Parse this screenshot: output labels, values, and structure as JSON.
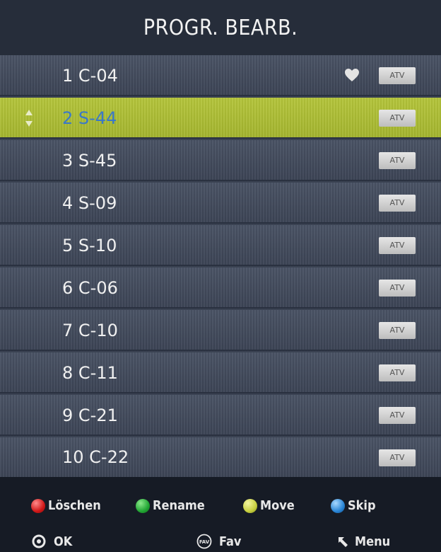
{
  "title": "PROGR. BEARB.",
  "channels": [
    {
      "label": "1 C-04",
      "badge": "ATV",
      "favorite": true,
      "selected": false
    },
    {
      "label": "2 S-44",
      "badge": "ATV",
      "favorite": false,
      "selected": true
    },
    {
      "label": "3 S-45",
      "badge": "ATV",
      "favorite": false,
      "selected": false
    },
    {
      "label": "4 S-09",
      "badge": "ATV",
      "favorite": false,
      "selected": false
    },
    {
      "label": "5 S-10",
      "badge": "ATV",
      "favorite": false,
      "selected": false
    },
    {
      "label": "6 C-06",
      "badge": "ATV",
      "favorite": false,
      "selected": false
    },
    {
      "label": "7 C-10",
      "badge": "ATV",
      "favorite": false,
      "selected": false
    },
    {
      "label": "8 C-11",
      "badge": "ATV",
      "favorite": false,
      "selected": false
    },
    {
      "label": "9 C-21",
      "badge": "ATV",
      "favorite": false,
      "selected": false
    },
    {
      "label": "10 C-22",
      "badge": "ATV",
      "favorite": false,
      "selected": false
    }
  ],
  "hints": {
    "red": "Löschen",
    "green": "Rename",
    "yellow": "Move",
    "blue": "Skip",
    "ok": "OK",
    "fav": "Fav",
    "fav_icon_text": "FAV",
    "menu": "Menu"
  },
  "colors": {
    "selected_row": "#a3b42e",
    "selected_text": "#3a78c8",
    "row": "#434b5d"
  },
  "icons": {
    "favorite": "heart-icon",
    "move": "up-down-arrows-icon",
    "ok": "ok-circle-icon",
    "fav": "fav-button-icon",
    "menu": "return-arrow-icon"
  }
}
